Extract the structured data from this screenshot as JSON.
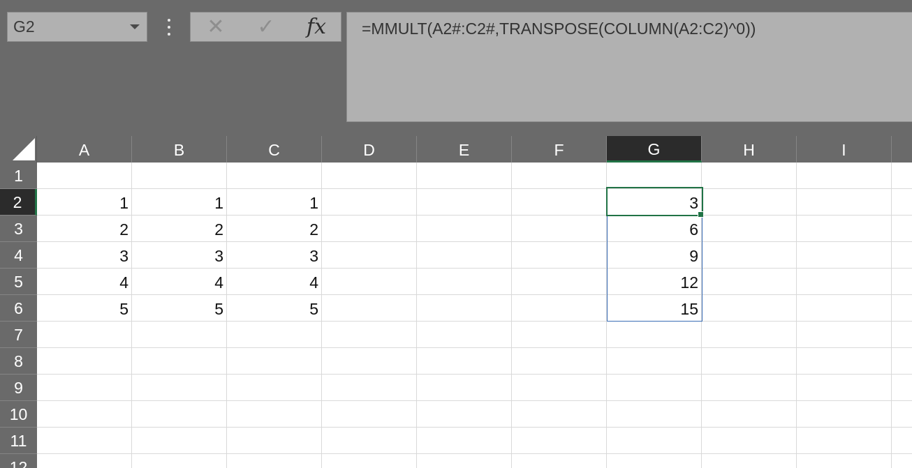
{
  "formula_bar": {
    "name_box": "G2",
    "formula": "=MMULT(A2#:C2#,TRANSPOSE(COLUMN(A2:C2)^0))",
    "cancel_glyph": "✕",
    "enter_glyph": "✓",
    "fx_label": "fx"
  },
  "columns": [
    "A",
    "B",
    "C",
    "D",
    "E",
    "F",
    "G",
    "H",
    "I"
  ],
  "rows": [
    "1",
    "2",
    "3",
    "4",
    "5",
    "6",
    "7",
    "8",
    "9",
    "10",
    "11",
    "12"
  ],
  "active_cell": "G2",
  "cells": {
    "A2": "1",
    "B2": "1",
    "C2": "1",
    "G2": "3",
    "A3": "2",
    "B3": "2",
    "C3": "2",
    "G3": "6",
    "A4": "3",
    "B4": "3",
    "C4": "3",
    "G4": "9",
    "A5": "4",
    "B5": "4",
    "C5": "4",
    "G5": "12",
    "A6": "5",
    "B6": "5",
    "C6": "5",
    "G6": "15"
  },
  "colors": {
    "chrome": "#6a6a6a",
    "active_header": "#2b2b2b",
    "selection": "#217346",
    "spill_border": "#3a6db5",
    "gridline": "#d9d9d9"
  },
  "icons": {
    "select_all": "select-all-triangle",
    "name_box_dropdown": "chevron-down-icon",
    "more": "vertical-ellipsis-icon"
  }
}
